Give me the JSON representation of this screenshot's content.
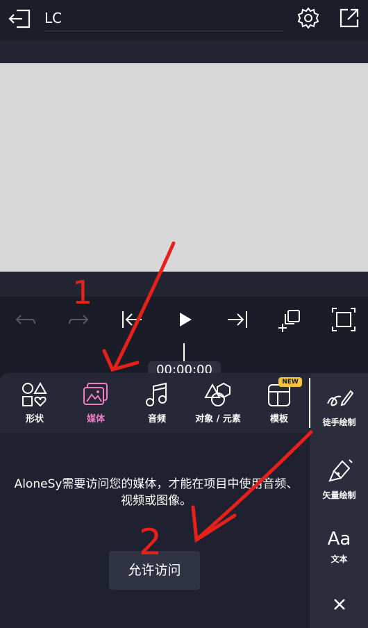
{
  "header": {
    "title": "LC",
    "icons": [
      "back-icon",
      "gear-icon",
      "share-icon"
    ]
  },
  "playback": {
    "time": "00:00:00",
    "icons": [
      "undo-icon",
      "redo-icon",
      "skip-start-icon",
      "play-icon",
      "skip-end-icon",
      "add-layer-icon",
      "fit-screen-icon"
    ]
  },
  "tools": {
    "shapes": "形状",
    "media": "媒体",
    "audio": "音频",
    "objects": "对象 / 元素",
    "templates": "模板",
    "new_badge": "NEW"
  },
  "right_tools": {
    "freehand": "徒手绘制",
    "vector": "矢量绘制",
    "text": "文本",
    "text_glyph": "Aa"
  },
  "permission": {
    "message": "AloneSy需要访问您的媒体，才能在项目中使用音频、视频或图像。",
    "allow_label": "允许访问"
  },
  "annotations": {
    "label_1": "1",
    "label_2": "2"
  },
  "colors": {
    "accent_active": "#f07cc6",
    "badge": "#f2c33b",
    "annotation": "#e8201a"
  }
}
